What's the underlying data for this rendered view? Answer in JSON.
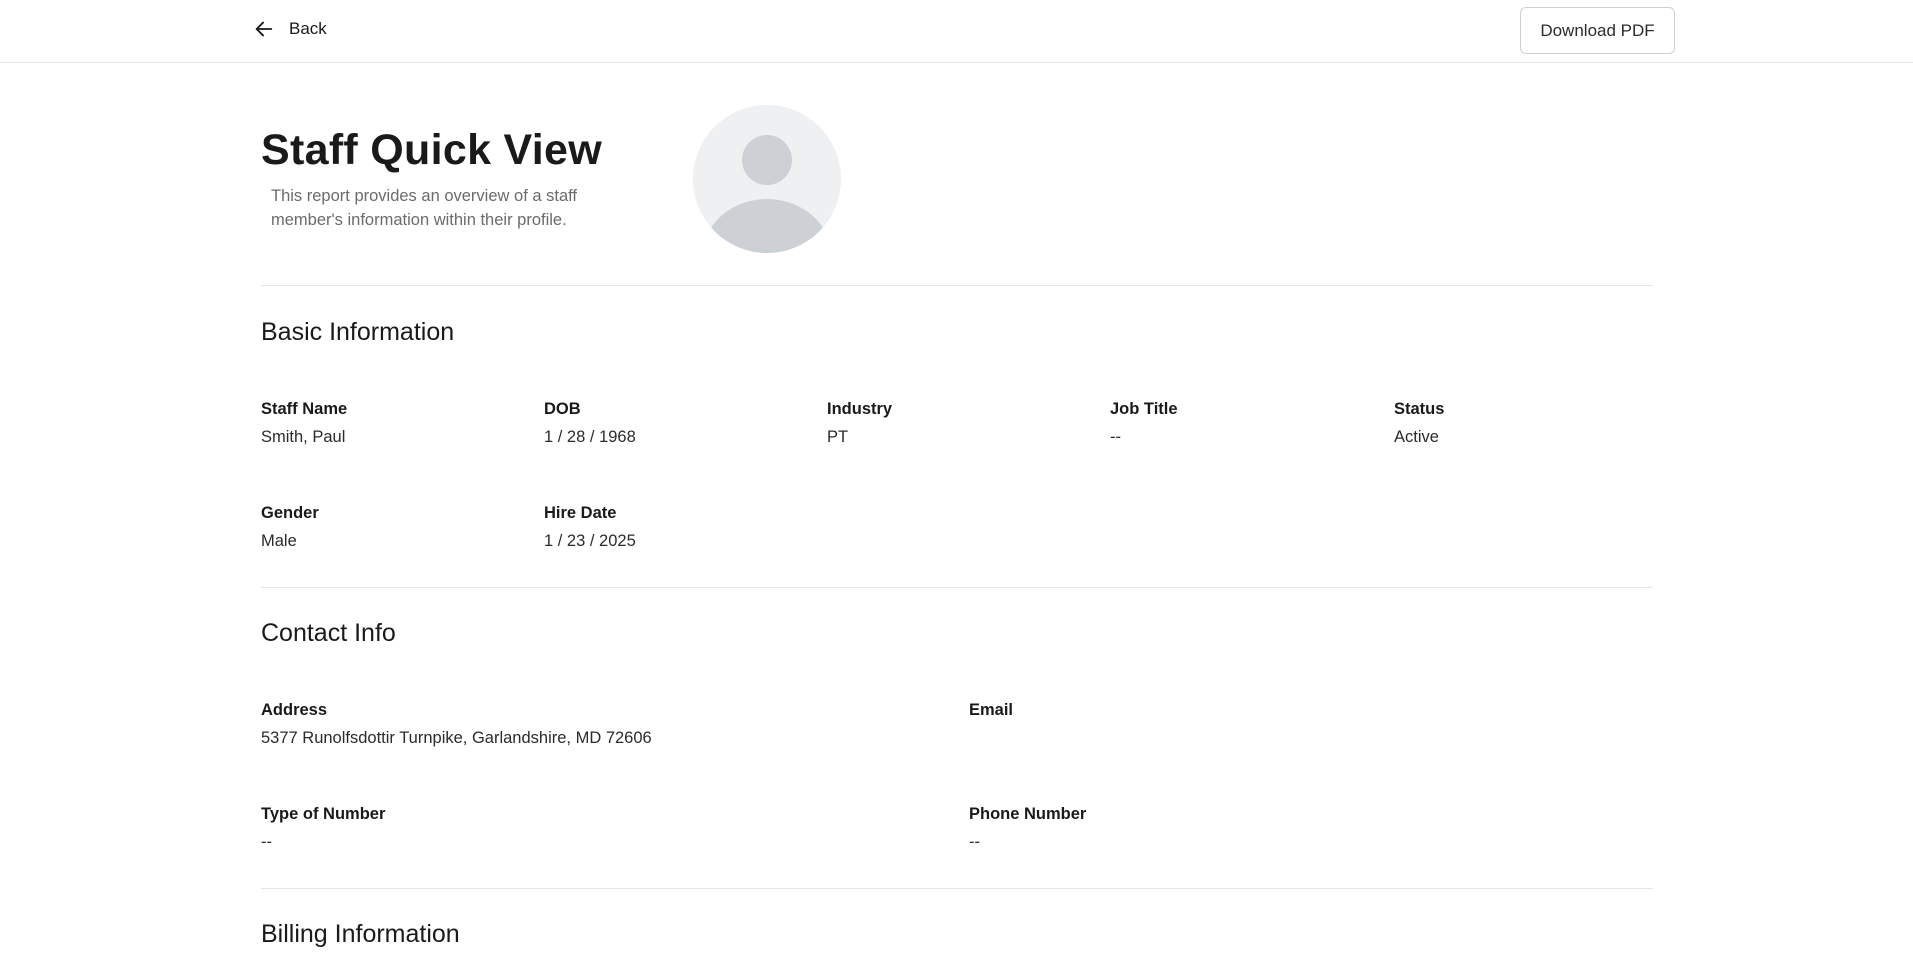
{
  "topbar": {
    "back_label": "Back",
    "download_label": "Download PDF"
  },
  "header": {
    "title": "Staff Quick View",
    "subtitle": "This report provides an overview of a staff member's information within their profile."
  },
  "basic_info": {
    "title": "Basic Information",
    "fields": [
      {
        "label": "Staff Name",
        "value": "Smith, Paul"
      },
      {
        "label": "DOB",
        "value": "1 / 28 / 1968"
      },
      {
        "label": "Industry",
        "value": "PT"
      },
      {
        "label": "Job Title",
        "value": "--"
      },
      {
        "label": "Status",
        "value": "Active"
      },
      {
        "label": "Gender",
        "value": "Male"
      },
      {
        "label": "Hire Date",
        "value": "1 / 23 / 2025"
      }
    ]
  },
  "contact_info": {
    "title": "Contact Info",
    "fields": [
      {
        "label": "Address",
        "value": "5377 Runolfsdottir Turnpike, Garlandshire, MD 72606"
      },
      {
        "label": "Email",
        "value": ""
      },
      {
        "label": "Type of Number",
        "value": "--"
      },
      {
        "label": "Phone Number",
        "value": "--"
      }
    ]
  },
  "billing_info": {
    "title": "Billing Information"
  },
  "icons": {
    "back": "arrow-left-icon",
    "avatar": "user-placeholder-icon"
  }
}
